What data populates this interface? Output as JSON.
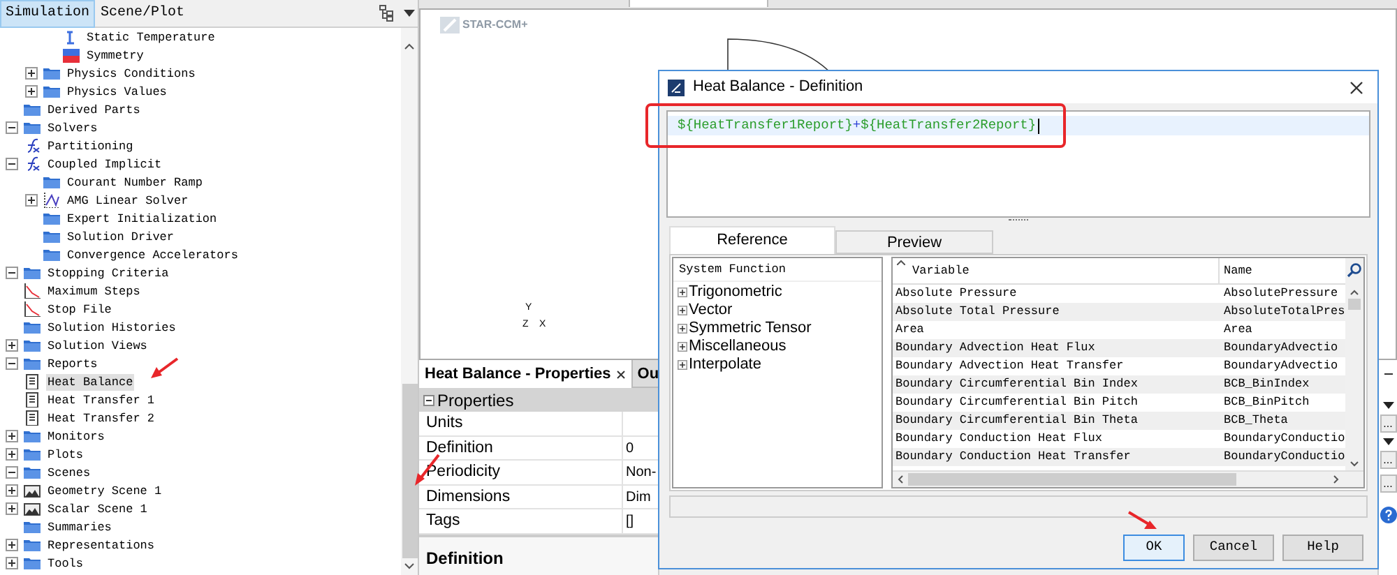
{
  "left_panel": {
    "tabs": [
      {
        "label": "Simulation",
        "selected": true
      },
      {
        "label": "Scene/Plot",
        "selected": false
      }
    ],
    "tree": [
      {
        "children": [
          {
            "children": [
              {
                "children": [
                  {
                    "label": "Static Temperature",
                    "kind": "temperature",
                    "selected": false
                  },
                  {
                    "label": "Symmetry",
                    "kind": "symmetry",
                    "selected": false
                  }
                ]
              },
              {
                "label": "Physics Conditions",
                "kind": "folder",
                "expanded": false,
                "selected": false
              },
              {
                "label": "Physics Values",
                "kind": "folder",
                "expanded": false,
                "selected": false
              }
            ]
          }
        ]
      },
      {
        "label": "Derived Parts",
        "kind": "folder",
        "selected": false
      },
      {
        "label": "Solvers",
        "kind": "folder",
        "expanded": true,
        "selected": false,
        "children": [
          {
            "label": "Partitioning",
            "kind": "function",
            "selected": false
          },
          {
            "label": "Coupled Implicit",
            "kind": "function",
            "expanded": true,
            "selected": false,
            "children": [
              {
                "label": "Courant Number Ramp",
                "kind": "folder",
                "selected": false
              },
              {
                "label": "AMG Linear Solver",
                "kind": "solver",
                "expanded": false,
                "selected": false
              },
              {
                "label": "Expert Initialization",
                "kind": "folder",
                "selected": false
              },
              {
                "label": "Solution Driver",
                "kind": "folder",
                "selected": false
              },
              {
                "label": "Convergence Accelerators",
                "kind": "folder",
                "selected": false
              }
            ]
          }
        ]
      },
      {
        "label": "Stopping Criteria",
        "kind": "folder",
        "expanded": true,
        "selected": false,
        "children": [
          {
            "label": "Maximum Steps",
            "kind": "stop",
            "selected": false
          },
          {
            "label": "Stop File",
            "kind": "stop",
            "selected": false
          }
        ]
      },
      {
        "label": "Solution Histories",
        "kind": "folder",
        "selected": false
      },
      {
        "label": "Solution Views",
        "kind": "folder",
        "expanded": false,
        "selected": false
      },
      {
        "label": "Reports",
        "kind": "folder",
        "expanded": true,
        "selected": false,
        "children": [
          {
            "label": "Heat Balance",
            "kind": "report",
            "selected": true
          },
          {
            "label": "Heat Transfer 1",
            "kind": "report",
            "selected": false
          },
          {
            "label": "Heat Transfer 2",
            "kind": "report",
            "selected": false
          }
        ]
      },
      {
        "label": "Monitors",
        "kind": "folder",
        "expanded": false,
        "selected": false
      },
      {
        "label": "Plots",
        "kind": "folder",
        "expanded": false,
        "selected": false
      },
      {
        "label": "Scenes",
        "kind": "folder",
        "expanded": true,
        "selected": false,
        "children": [
          {
            "label": "Geometry Scene 1",
            "kind": "scene",
            "expanded": false,
            "selected": false
          },
          {
            "label": "Scalar Scene 1",
            "kind": "scene",
            "expanded": false,
            "selected": false
          }
        ]
      },
      {
        "label": "Summaries",
        "kind": "folder",
        "selected": false
      },
      {
        "label": "Representations",
        "kind": "folder",
        "expanded": false,
        "selected": false
      },
      {
        "label": "Tools",
        "kind": "folder",
        "expanded": false,
        "selected": false
      }
    ]
  },
  "canvas": {
    "logo_text": "STAR-CCM+",
    "axes": [
      "Y",
      "Z",
      "X"
    ]
  },
  "properties_panel": {
    "tabs": [
      {
        "label": "Heat Balance - Properties",
        "selected": true
      },
      {
        "label": "Ou",
        "selected": false
      }
    ],
    "section": {
      "label": "Properties",
      "expanded": true
    },
    "rows": [
      {
        "name": "Units"
      },
      {
        "name": "Definition",
        "value": "0"
      },
      {
        "name": "Periodicity",
        "value": "Non-"
      },
      {
        "name": "Dimensions",
        "value": "Dim"
      },
      {
        "name": "Tags",
        "value": "[]"
      }
    ],
    "description_title": "Definition"
  },
  "side_buttons": [
    "...",
    "...",
    "..."
  ],
  "dialog": {
    "title": "Heat Balance - Definition",
    "expression": [
      {
        "text": "${HeatTransfer1Report}",
        "kind": "reference"
      },
      {
        "text": "+",
        "kind": "operator"
      },
      {
        "text": "${HeatTransfer2Report}",
        "kind": "reference"
      }
    ],
    "tabs": [
      {
        "label": "Reference",
        "selected": true
      },
      {
        "label": "Preview",
        "selected": false
      }
    ],
    "function_tree": {
      "header": "System Function",
      "items": [
        {
          "label": "Trigonometric",
          "expanded": false
        },
        {
          "label": "Vector",
          "expanded": false
        },
        {
          "label": "Symmetric Tensor",
          "expanded": false
        },
        {
          "label": "Miscellaneous",
          "expanded": false
        },
        {
          "label": "Interpolate",
          "expanded": false
        }
      ]
    },
    "variables": {
      "columns": [
        "Variable",
        "Name"
      ],
      "rows": [
        {
          "variable": "Absolute Pressure",
          "name": "AbsolutePressure"
        },
        {
          "variable": "Absolute Total Pressure",
          "name": "AbsoluteTotalPres"
        },
        {
          "variable": "Area",
          "name": "Area"
        },
        {
          "variable": "Boundary Advection Heat Flux",
          "name": "BoundaryAdvectio"
        },
        {
          "variable": "Boundary Advection Heat Transfer",
          "name": "BoundaryAdvectio"
        },
        {
          "variable": "Boundary Circumferential Bin Index",
          "name": "BCB_BinIndex"
        },
        {
          "variable": "Boundary Circumferential Bin Pitch",
          "name": "BCB_BinPitch"
        },
        {
          "variable": "Boundary Circumferential Bin Theta",
          "name": "BCB_Theta"
        },
        {
          "variable": "Boundary Conduction Heat Flux",
          "name": "BoundaryConductio"
        },
        {
          "variable": "Boundary Conduction Heat Transfer",
          "name": "BoundaryConductio"
        }
      ]
    },
    "buttons": [
      {
        "label": "OK",
        "default": true
      },
      {
        "label": "Cancel",
        "default": false
      },
      {
        "label": "Help",
        "default": false
      }
    ]
  }
}
